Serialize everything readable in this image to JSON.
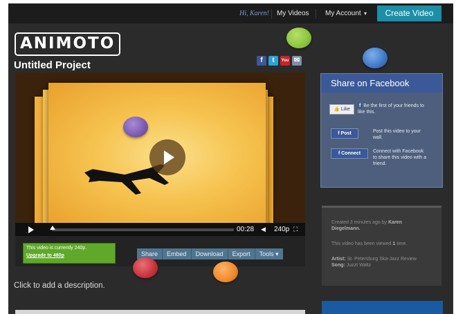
{
  "topbar": {
    "greeting": "Hi, Karen!",
    "my_videos": "My Videos",
    "my_account": "My Account",
    "create_video": "Create Video"
  },
  "logo_text": "ANIMOTO",
  "project_title": "Untitled Project",
  "social_icons": [
    "facebook-icon",
    "twitter-icon",
    "youtube-icon",
    "email-icon"
  ],
  "player": {
    "time": "00:28",
    "quality": "240p",
    "progress": 0.0
  },
  "upgrade": {
    "notice": "This video is currently 240p.",
    "link": "Upgrade to 480p"
  },
  "tools": [
    {
      "label": "Share",
      "name": "share-button"
    },
    {
      "label": "Embed",
      "name": "embed-button"
    },
    {
      "label": "Download",
      "name": "download-button"
    },
    {
      "label": "Export",
      "name": "export-button"
    },
    {
      "label": "Tools",
      "name": "tools-button"
    }
  ],
  "description_placeholder": "Click to add a description.",
  "facebook": {
    "title": "Share on Facebook",
    "like_label": "Like",
    "like_text": "Be the first of your friends to like this.",
    "post_label": "Post",
    "post_text": "Post this video to your wall.",
    "connect_label": "Connect",
    "connect_text": "Connect with Facebook to share this video with a friend."
  },
  "info": {
    "created_prefix": "Created 3 minutes ago by",
    "created_by": "Karen Diegelmann.",
    "viewed_prefix": "This video has been viewed",
    "viewed_count": "1",
    "viewed_suffix": "time.",
    "artist_label": "Artist:",
    "artist": "St. Petersburg Ska-Jazz Review",
    "song_label": "Song:",
    "song": "Juzzt Waltz"
  },
  "colors": {
    "create_button": "#1b8fa8",
    "facebook_blue": "#3b5998",
    "upgrade_green": "#5fa82a",
    "marker_green": "#8cc43c",
    "marker_blue": "#3f78c8",
    "marker_purple": "#7a5ab0",
    "marker_red": "#c8323a",
    "marker_orange": "#f08a2a"
  }
}
